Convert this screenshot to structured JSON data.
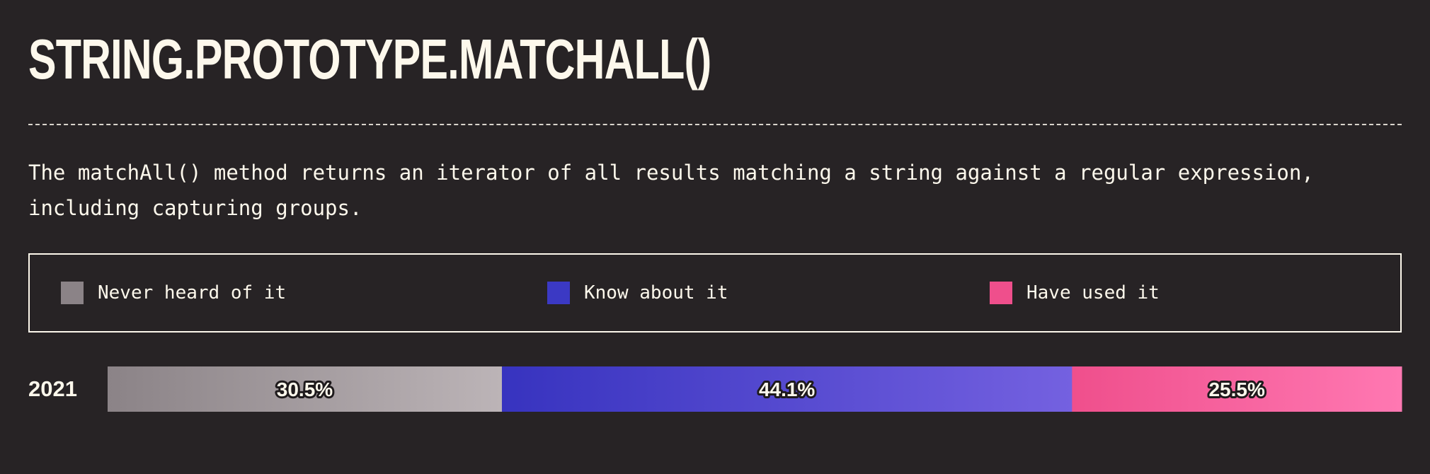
{
  "title": "STRING.PROTOTYPE.MATCHALL()",
  "description": "The matchAll() method returns an iterator of all results matching a string against a regular expression, including capturing groups.",
  "legend": {
    "items": [
      {
        "label": "Never heard of it",
        "color": "#8b8387"
      },
      {
        "label": "Know about it",
        "color": "#3b39c4"
      },
      {
        "label": "Have used it",
        "color": "#ef4f8c"
      }
    ]
  },
  "chart_data": {
    "type": "bar",
    "orientation": "horizontal-stacked",
    "categories": [
      "2021"
    ],
    "series": [
      {
        "name": "Never heard of it",
        "values": [
          30.5
        ],
        "label": "30.5%",
        "color_start": "#8b8387",
        "color_end": "#bcb4b7"
      },
      {
        "name": "Know about it",
        "values": [
          44.1
        ],
        "label": "44.1%",
        "color_start": "#3733bf",
        "color_end": "#7461e0"
      },
      {
        "name": "Have used it",
        "values": [
          25.5
        ],
        "label": "25.5%",
        "color_start": "#ef4f8c",
        "color_end": "#ff78b2"
      }
    ],
    "unit": "%",
    "legend": "top",
    "grid": false
  }
}
